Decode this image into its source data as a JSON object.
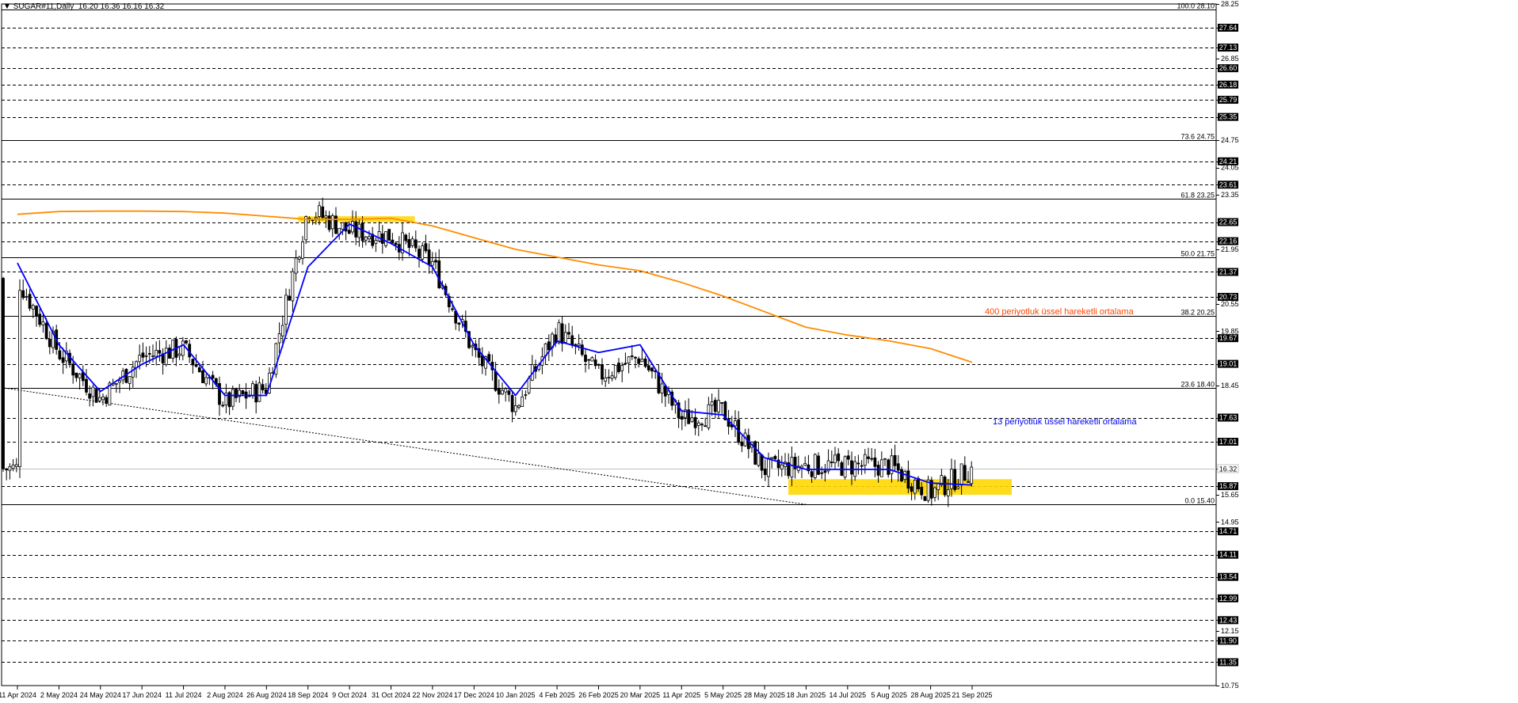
{
  "header": {
    "menu_icon": "triangle-down-icon",
    "symbol": "SUGAR#11,Daily",
    "ohlc": "16.20 16.36 16.16 16.32"
  },
  "colors": {
    "ema13": "#0000ff",
    "ema400": "#ff8c00",
    "bull_candle": "#000000",
    "bear_candle": "#000000",
    "support_zone": "#ffd700",
    "annot_ema400": "#ff4500",
    "annot_ema13": "#0000ff"
  },
  "chart_data": {
    "type": "candlestick",
    "symbol": "SUGAR#11",
    "timeframe": "Daily",
    "ylim": [
      10.75,
      28.25
    ],
    "price_axis_labels": [
      "28.25",
      "27.64",
      "27.13",
      "26.85",
      "26.60",
      "26.18",
      "25.79",
      "25.35",
      "24.75",
      "24.21",
      "24.05",
      "23.61",
      "23.35",
      "22.65",
      "22.16",
      "21.95",
      "21.37",
      "20.73",
      "20.55",
      "19.85",
      "19.67",
      "19.01",
      "18.45",
      "17.63",
      "17.01",
      "16.32",
      "15.87",
      "15.65",
      "14.95",
      "14.71",
      "14.11",
      "13.54",
      "12.99",
      "12.43",
      "12.15",
      "11.90",
      "11.35",
      "10.75"
    ],
    "highlighted_price_labels": [
      "27.64",
      "27.13",
      "26.60",
      "26.18",
      "25.79",
      "25.35",
      "24.21",
      "23.61",
      "22.65",
      "22.16",
      "21.37",
      "20.73",
      "19.67",
      "19.01",
      "17.63",
      "17.01",
      "16.32",
      "15.87",
      "14.71",
      "14.11",
      "13.54",
      "12.99",
      "12.43",
      "11.90",
      "11.35"
    ],
    "x_axis_labels": [
      "11 Apr 2024",
      "2 May 2024",
      "24 May 2024",
      "17 Jun 2024",
      "11 Jul 2024",
      "2 Aug 2024",
      "26 Aug 2024",
      "18 Sep 2024",
      "9 Oct 2024",
      "31 Oct 2024",
      "22 Nov 2024",
      "17 Dec 2024",
      "10 Jan 2025",
      "4 Feb 2025",
      "26 Feb 2025",
      "20 Mar 2025",
      "11 Apr 2025",
      "5 May 2025",
      "28 May 2025",
      "18 Jun 2025",
      "14 Jul 2025",
      "5 Aug 2025",
      "28 Aug 2025",
      "21 Sep 2025"
    ],
    "fibonacci_levels": [
      {
        "label": "100.0 28.10",
        "price": 28.1
      },
      {
        "label": "73.6 24.75",
        "price": 24.75
      },
      {
        "label": "61.8 23.25",
        "price": 23.25
      },
      {
        "label": "50.0 21.75",
        "price": 21.75
      },
      {
        "label": "38.2 20.25",
        "price": 20.25
      },
      {
        "label": "23.6 18.40",
        "price": 18.4
      },
      {
        "label": "0.0 15.40",
        "price": 15.4
      }
    ],
    "current_price": 16.32,
    "close_path": [
      [
        "11 Apr 2024",
        21.2
      ],
      [
        "2 May 2024",
        19.3
      ],
      [
        "24 May 2024",
        18.1
      ],
      [
        "17 Jun 2024",
        19.2
      ],
      [
        "11 Jul 2024",
        19.4
      ],
      [
        "2 Aug 2024",
        18.0
      ],
      [
        "26 Aug 2024",
        18.4
      ],
      [
        "18 Sep 2024",
        23.0
      ],
      [
        "9 Oct 2024",
        22.4
      ],
      [
        "31 Oct 2024",
        22.3
      ],
      [
        "22 Nov 2024",
        21.6
      ],
      [
        "17 Dec 2024",
        19.3
      ],
      [
        "10 Jan 2025",
        17.9
      ],
      [
        "4 Feb 2025",
        19.9
      ],
      [
        "26 Feb 2025",
        18.7
      ],
      [
        "20 Mar 2025",
        19.2
      ],
      [
        "11 Apr 2025",
        17.6
      ],
      [
        "5 May 2025",
        17.8
      ],
      [
        "28 May 2025",
        16.3
      ],
      [
        "18 Jun 2025",
        16.4
      ],
      [
        "14 Jul 2025",
        16.4
      ],
      [
        "5 Aug 2025",
        16.4
      ],
      [
        "28 Aug 2025",
        15.7
      ],
      [
        "21 Sep 2025",
        16.32
      ]
    ],
    "ema13_path": [
      [
        "11 Apr 2024",
        21.6
      ],
      [
        "2 May 2024",
        19.5
      ],
      [
        "24 May 2024",
        18.3
      ],
      [
        "17 Jun 2024",
        19.0
      ],
      [
        "11 Jul 2024",
        19.5
      ],
      [
        "2 Aug 2024",
        18.2
      ],
      [
        "26 Aug 2024",
        18.2
      ],
      [
        "18 Sep 2024",
        21.5
      ],
      [
        "9 Oct 2024",
        22.6
      ],
      [
        "31 Oct 2024",
        22.1
      ],
      [
        "22 Nov 2024",
        21.5
      ],
      [
        "17 Dec 2024",
        19.5
      ],
      [
        "10 Jan 2025",
        18.2
      ],
      [
        "4 Feb 2025",
        19.6
      ],
      [
        "26 Feb 2025",
        19.3
      ],
      [
        "20 Mar 2025",
        19.5
      ],
      [
        "11 Apr 2025",
        17.8
      ],
      [
        "5 May 2025",
        17.7
      ],
      [
        "28 May 2025",
        16.6
      ],
      [
        "18 Jun 2025",
        16.3
      ],
      [
        "14 Jul 2025",
        16.3
      ],
      [
        "5 Aug 2025",
        16.3
      ],
      [
        "28 Aug 2025",
        15.95
      ],
      [
        "21 Sep 2025",
        15.9
      ]
    ],
    "ema400_path": [
      [
        "11 Apr 2024",
        22.85
      ],
      [
        "2 May 2024",
        22.92
      ],
      [
        "24 May 2024",
        22.93
      ],
      [
        "17 Jun 2024",
        22.93
      ],
      [
        "11 Jul 2024",
        22.92
      ],
      [
        "2 Aug 2024",
        22.88
      ],
      [
        "26 Aug 2024",
        22.8
      ],
      [
        "18 Sep 2024",
        22.72
      ],
      [
        "9 Oct 2024",
        22.72
      ],
      [
        "31 Oct 2024",
        22.75
      ],
      [
        "22 Nov 2024",
        22.55
      ],
      [
        "17 Dec 2024",
        22.25
      ],
      [
        "10 Jan 2025",
        21.95
      ],
      [
        "4 Feb 2025",
        21.75
      ],
      [
        "26 Feb 2025",
        21.55
      ],
      [
        "20 Mar 2025",
        21.4
      ],
      [
        "11 Apr 2025",
        21.1
      ],
      [
        "5 May 2025",
        20.75
      ],
      [
        "28 May 2025",
        20.35
      ],
      [
        "18 Jun 2025",
        19.95
      ],
      [
        "14 Jul 2025",
        19.75
      ],
      [
        "5 Aug 2025",
        19.6
      ],
      [
        "28 Aug 2025",
        19.4
      ],
      [
        "21 Sep 2025",
        19.05
      ]
    ],
    "support_zone": {
      "from": "28 May 2025",
      "to": "21 Sep 2025",
      "low": 15.65,
      "high": 16.05
    },
    "resistance_zone": {
      "from": "26 Aug 2024",
      "to": "31 Oct 2024",
      "low": 22.65,
      "high": 22.8
    },
    "trendline": {
      "from": [
        "11 Apr 2024",
        18.4
      ],
      "to": [
        "18 Jun 2025",
        15.4
      ]
    },
    "annotations": [
      {
        "text": "400 periyotluk üssel hareketli ortalama",
        "series": "ema400"
      },
      {
        "text": "13 periyotluk üssel hareketli ortalama",
        "series": "ema13"
      }
    ]
  }
}
